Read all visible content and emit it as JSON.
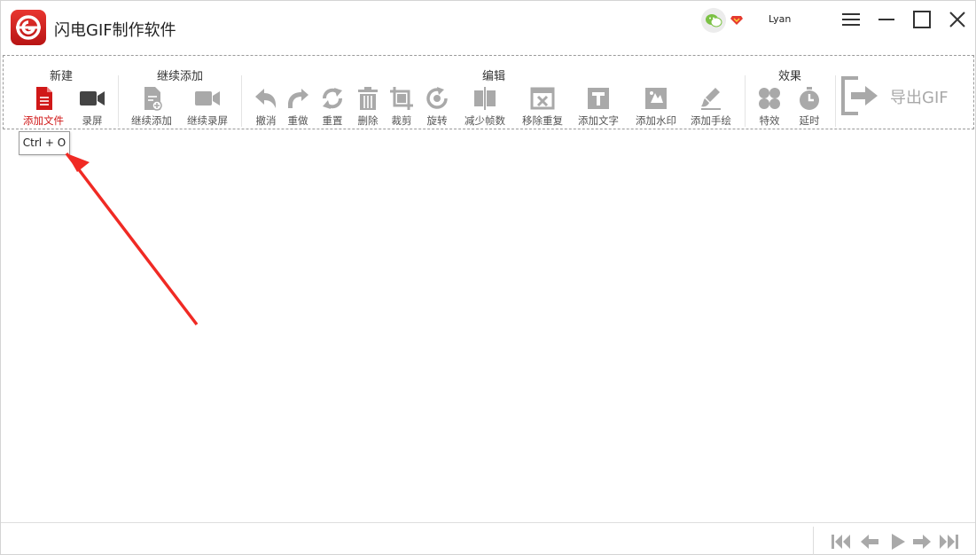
{
  "app": {
    "title": "闪电GIF制作软件",
    "user": "Lyan",
    "accent": "#d01818",
    "icon_gray": "#a9a9a9"
  },
  "toolbar": {
    "groups": {
      "new": "新建",
      "continue": "继续添加",
      "edit": "编辑",
      "effects": "效果"
    },
    "tools": {
      "add_file": "添加文件",
      "record": "录屏",
      "continue_add": "继续添加",
      "continue_record": "继续录屏",
      "undo": "撤消",
      "redo": "重做",
      "reset": "重置",
      "delete": "删除",
      "crop": "裁剪",
      "rotate": "旋转",
      "reduce_frames": "减少帧数",
      "remove_dup": "移除重复",
      "add_text": "添加文字",
      "add_watermark": "添加水印",
      "add_draw": "添加手绘",
      "effect": "特效",
      "delay": "延时"
    },
    "export": "导出GIF"
  },
  "tooltip": "Ctrl + O",
  "icons": {
    "logo": "app-logo-icon",
    "wechat": "wechat-icon",
    "vip": "vip-diamond-icon",
    "menu": "menu-icon",
    "minimize": "minimize-icon",
    "maximize": "maximize-icon",
    "close": "close-icon",
    "first": "first-frame-icon",
    "prev": "prev-frame-icon",
    "play": "play-icon",
    "next": "next-frame-icon",
    "last": "last-frame-icon"
  }
}
